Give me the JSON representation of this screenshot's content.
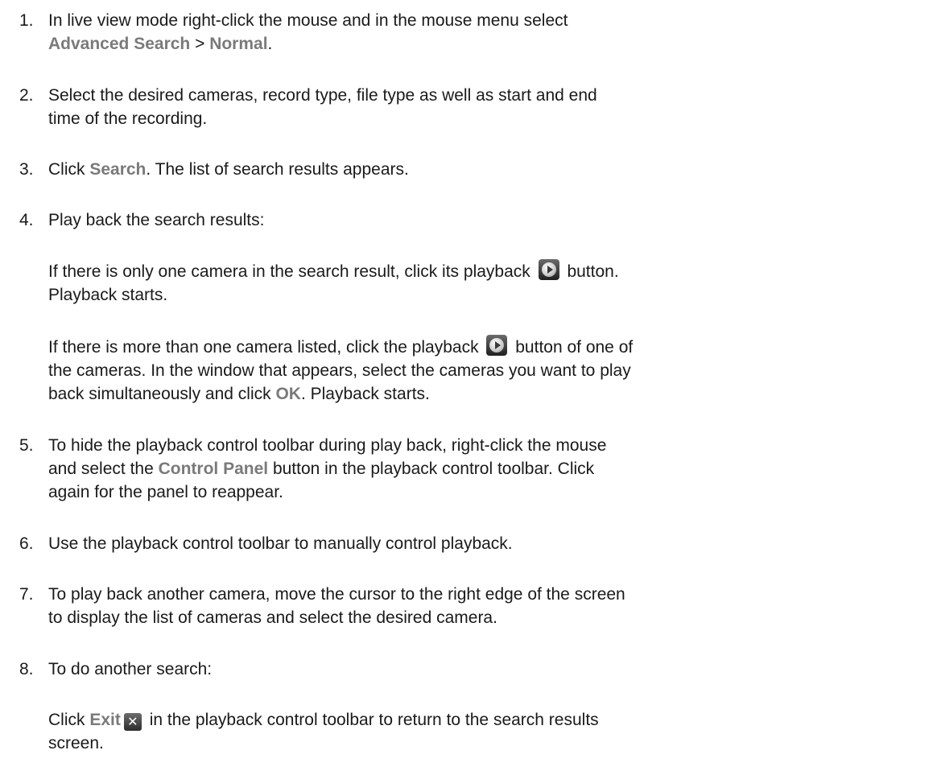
{
  "steps": [
    {
      "number": "1.",
      "text_a": "In live view mode right-click the mouse and in the mouse menu select",
      "ui_1": "Advanced Search",
      "sep": " > ",
      "ui_2": "Normal",
      "end": "."
    },
    {
      "number": "2.",
      "text_a": "Select the desired cameras, record type, file type as well as start and end",
      "text_b": "time of the recording."
    },
    {
      "number": "3.",
      "pre": "Click ",
      "ui_1": "Search",
      "post": ". The list of search results appears."
    },
    {
      "number": "4.",
      "text_a": "Play back the search results:",
      "para1": {
        "pre": "If there is only one camera in the search result, click its playback ",
        "icon": "playback-icon",
        "post": " button.",
        "line2": "Playback starts."
      },
      "para2": {
        "pre": "If there is more than one camera listed, click the playback ",
        "icon": "playback-icon",
        "post": " button of one of",
        "line2": "the cameras. In the window that appears, select the cameras you want to play",
        "line3_pre": "back simultaneously and click ",
        "ui": "OK",
        "line3_post": ". Playback starts."
      }
    },
    {
      "number": "5.",
      "text_a": "To hide the playback control toolbar during play back, right-click the mouse",
      "line2_pre": "and select the ",
      "ui_1": "Control Panel",
      "line2_post": " button in the playback control toolbar. Click",
      "text_c": "again for the panel to reappear."
    },
    {
      "number": "6.",
      "text_a": "Use the playback control toolbar to manually control playback."
    },
    {
      "number": "7.",
      "text_a": "To play back another camera, move the cursor to the right edge of the screen",
      "text_b": "to display the list of cameras and select the desired camera."
    },
    {
      "number": "8.",
      "text_a": "To do another search:",
      "para1": {
        "pre": "Click ",
        "ui": "Exit",
        "icon": "exit-icon",
        "post": " in the playback control toolbar to return to the search results",
        "line2": "screen."
      }
    }
  ],
  "colors": {
    "text": "#1a1a1a",
    "ui_term": "#7a7a7a"
  }
}
